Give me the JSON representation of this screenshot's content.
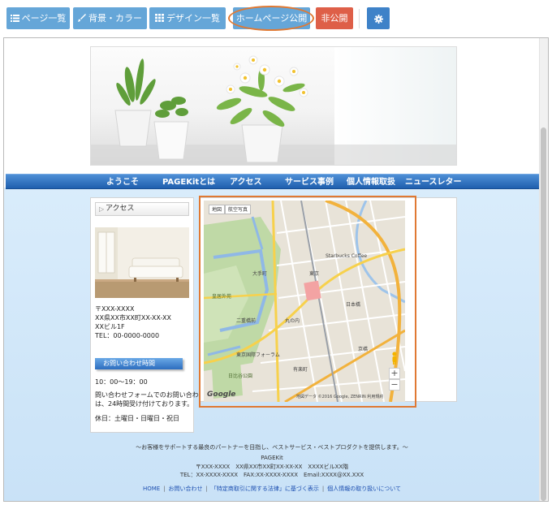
{
  "toolbar": {
    "pages_label": "ページ一覧",
    "bg_label": "背景・カラー",
    "design_label": "デザイン一覧",
    "publish_label": "ホームページ公開",
    "unpublish_label": "非公開",
    "pages_icon": "list-icon",
    "bg_icon": "brush-icon",
    "design_icon": "grid-icon",
    "settings_icon": "gear-icon"
  },
  "nav": {
    "items": [
      "ようこそ",
      "PAGEKitとは",
      "アクセス",
      "サービス事例",
      "個人情報取扱",
      "ニュースレター"
    ]
  },
  "sidebar": {
    "heading": "アクセス",
    "address_lines": [
      "〒XXX-XXXX",
      "XX県XX市XX町XX-XX-XX",
      "XXビル1F",
      "TEL：00-0000-0000"
    ],
    "contact_heading": "お問い合わせ時間",
    "hours": "10：00〜19：00",
    "form_note_lines": [
      "問い合わせフォームでのお問い合わせ",
      "は、24時間受け付けております。"
    ],
    "holidays": "休日：土曜日・日曜日・祝日"
  },
  "map": {
    "type_map": "地図",
    "type_sat": "航空写真",
    "google": "Google",
    "attribution": "地図データ ©2016 Google, ZENRIN 利用規約",
    "zoom_in": "+",
    "zoom_out": "−",
    "labels": [
      "日比谷公園",
      "皇居外苑",
      "有楽町",
      "東京国際フォーラム",
      "二重橋前",
      "大手町",
      "日本橋",
      "京橋",
      "Starbucks Coffee",
      "丸の内",
      "東京"
    ]
  },
  "footer": {
    "tagline": "〜お客様をサポートする最良のパートナーを目指し、ベストサービス・ベストプロダクトを提供します。〜",
    "company": "PAGEKit",
    "address": "〒XXX-XXXX　XX県XX市XX町XX-XX-XX　XXXXビルXX階",
    "contacts": "TEL：XX-XXXX-XXXX　FAX:XX-XXXX-XXXX　Email:XXXX@XX.XXX",
    "links": [
      "HOME",
      "お問い合わせ",
      "「特定商取引に関する法律」に基づく表示",
      "個人情報の取り扱いについて"
    ]
  },
  "colors": {
    "toolbar_button": "#65a6d8",
    "unpublish_button": "#de5f48",
    "settings_button": "#3e82c8",
    "highlight": "#e07933",
    "nav": "#2b6cc0",
    "page_bg": "#d3e8fa"
  }
}
